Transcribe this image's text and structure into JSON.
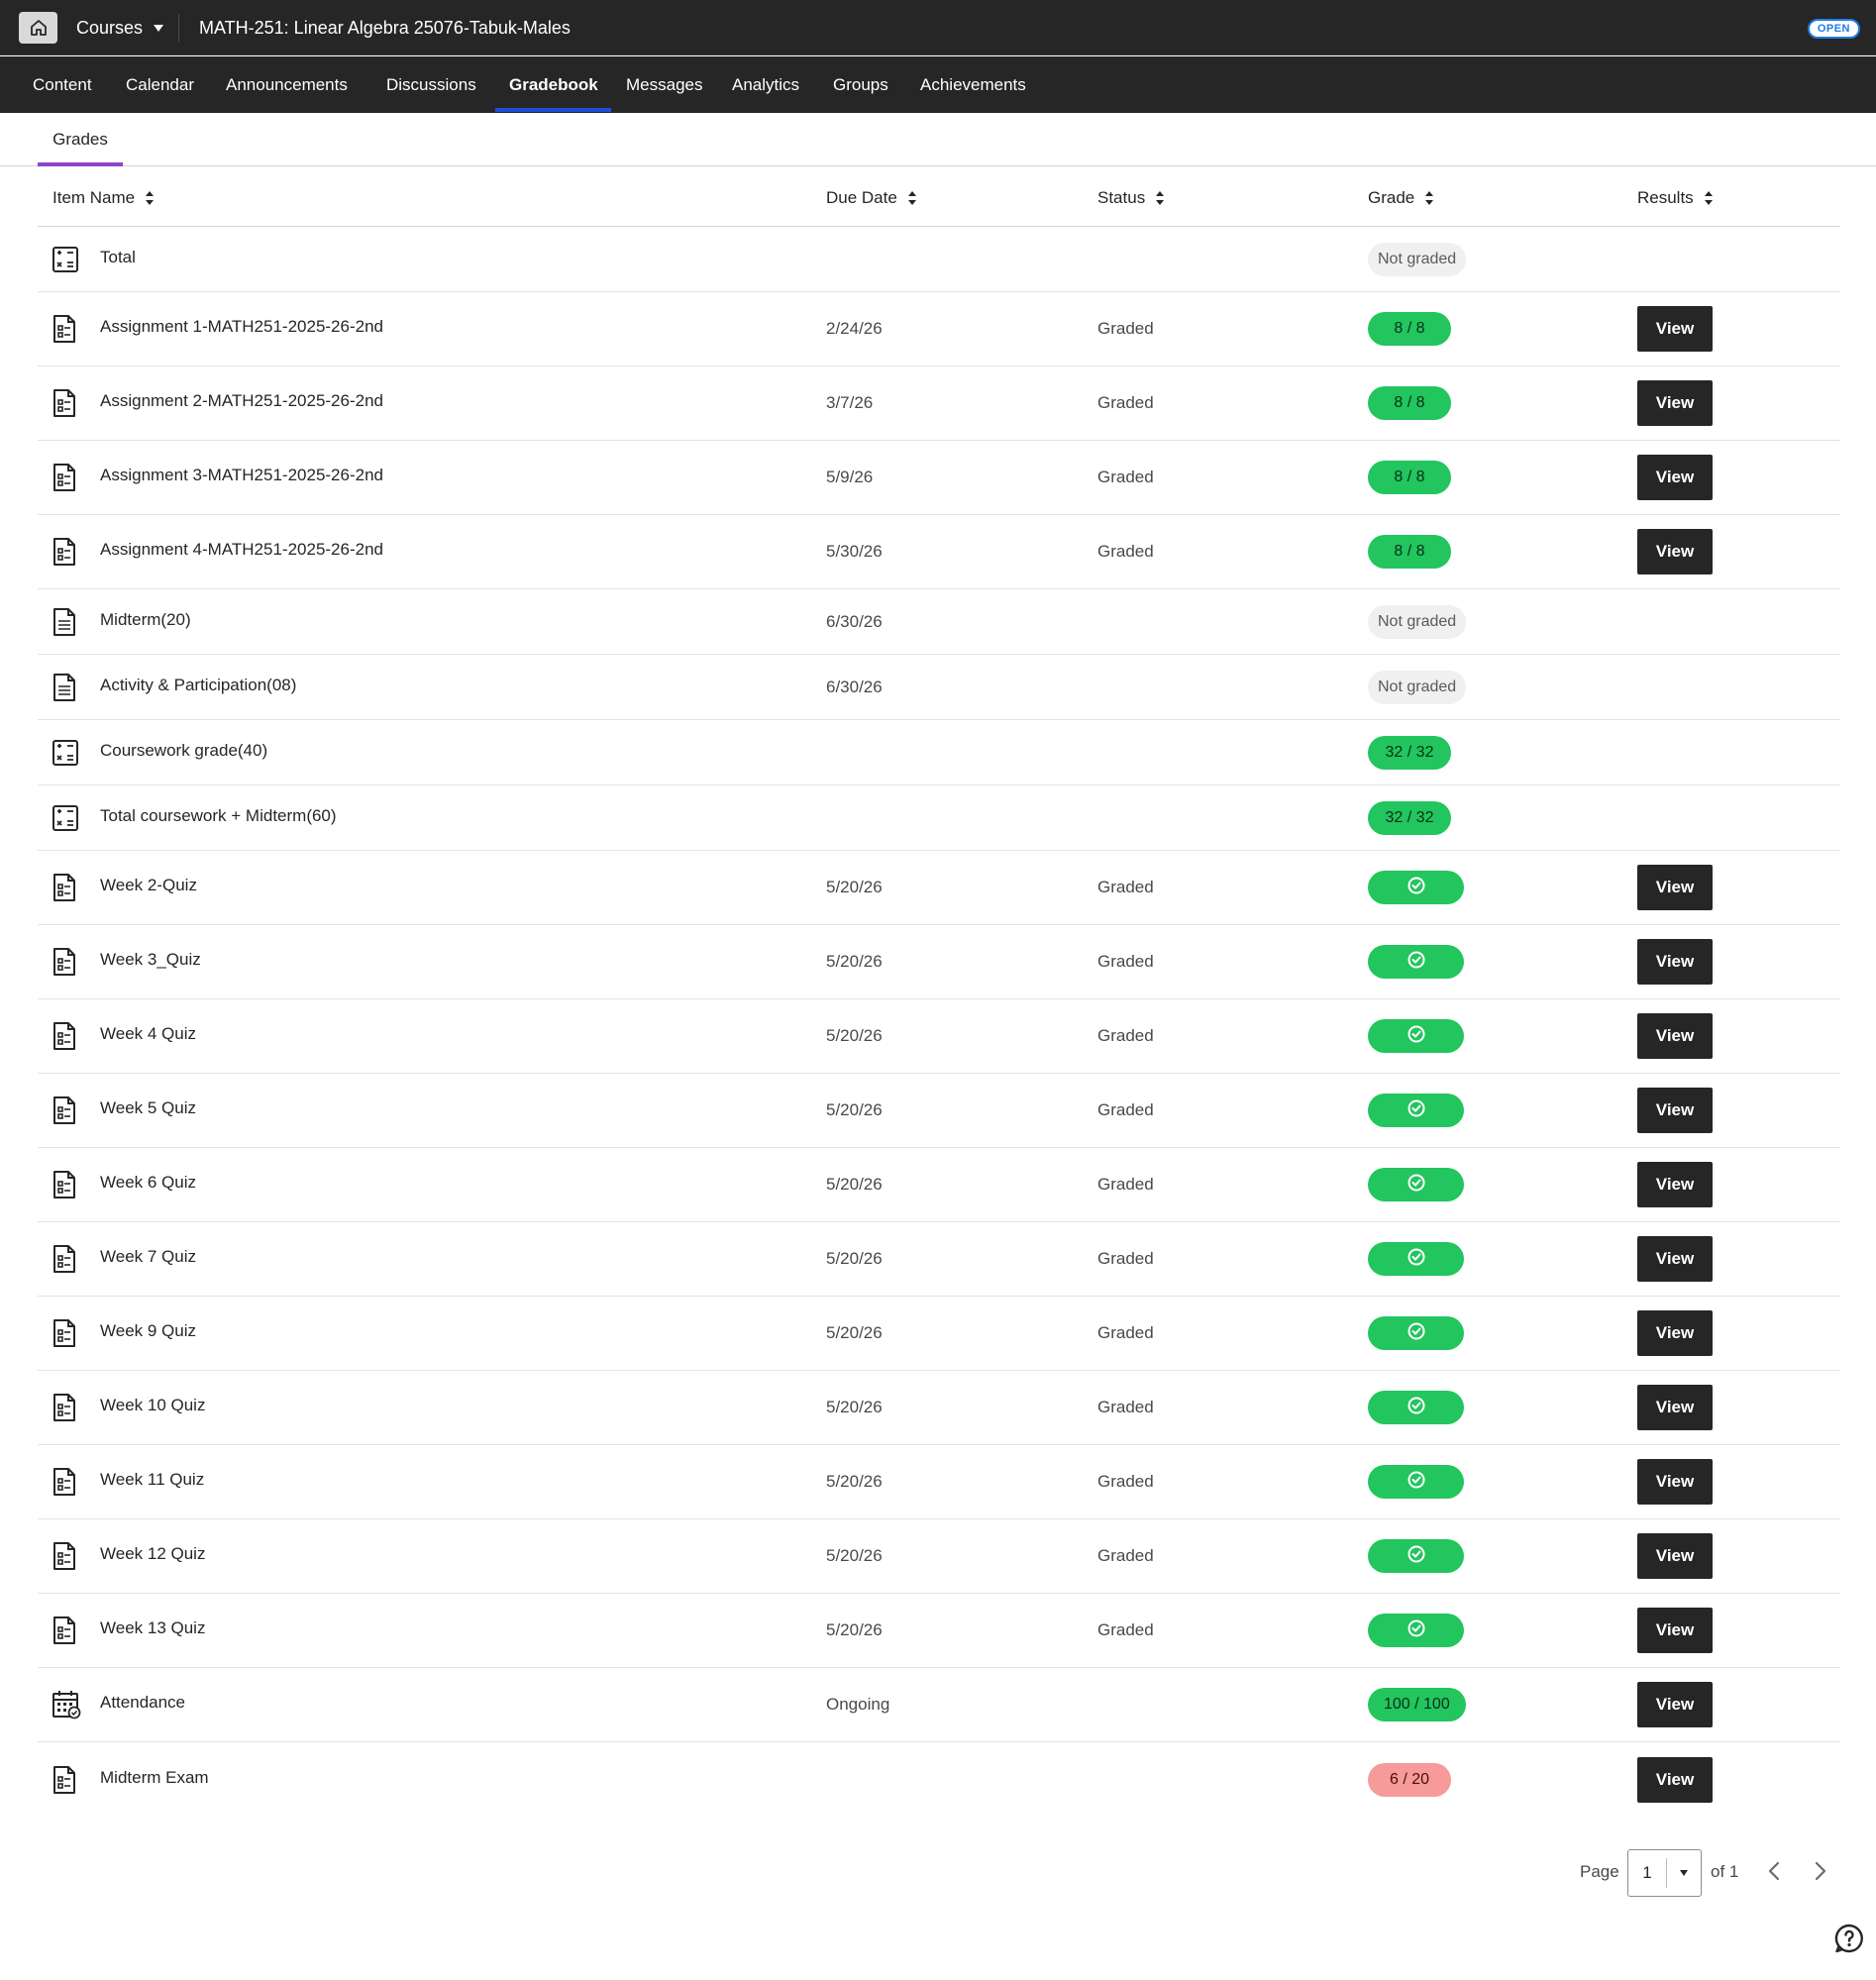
{
  "header": {
    "courses_label": "Courses",
    "course_title": "MATH-251: Linear Algebra 25076-Tabuk-Males",
    "badge": "OPEN"
  },
  "nav": {
    "items": [
      "Content",
      "Calendar",
      "Announcements",
      "Discussions",
      "Gradebook",
      "Messages",
      "Analytics",
      "Groups",
      "Achievements"
    ],
    "active": "Gradebook"
  },
  "subtabs": {
    "active": "Grades"
  },
  "table": {
    "columns": [
      "Item Name",
      "Due Date",
      "Status",
      "Grade",
      "Results"
    ],
    "rows": [
      {
        "icon": "calculator-icon",
        "name": "Total",
        "due": "",
        "status": "",
        "grade": "Not graded",
        "grade_style": "grey",
        "result": ""
      },
      {
        "icon": "assignment-icon",
        "name": "Assignment 1-MATH251-2025-26-2nd",
        "due": "2/24/26",
        "status": "Graded",
        "grade": "8 / 8",
        "grade_style": "green",
        "result": "View"
      },
      {
        "icon": "assignment-icon",
        "name": "Assignment 2-MATH251-2025-26-2nd",
        "due": "3/7/26",
        "status": "Graded",
        "grade": "8 / 8",
        "grade_style": "green",
        "result": "View"
      },
      {
        "icon": "assignment-icon",
        "name": "Assignment 3-MATH251-2025-26-2nd",
        "due": "5/9/26",
        "status": "Graded",
        "grade": "8 / 8",
        "grade_style": "green",
        "result": "View"
      },
      {
        "icon": "assignment-icon",
        "name": "Assignment 4-MATH251-2025-26-2nd",
        "due": "5/30/26",
        "status": "Graded",
        "grade": "8 / 8",
        "grade_style": "green",
        "result": "View"
      },
      {
        "icon": "document-icon",
        "name": "Midterm(20)",
        "due": "6/30/26",
        "status": "",
        "grade": "Not graded",
        "grade_style": "grey",
        "result": ""
      },
      {
        "icon": "document-icon",
        "name": "Activity & Participation(08)",
        "due": "6/30/26",
        "status": "",
        "grade": "Not graded",
        "grade_style": "grey",
        "result": ""
      },
      {
        "icon": "calculator-icon",
        "name": "Coursework grade(40)",
        "due": "",
        "status": "",
        "grade": "32 / 32",
        "grade_style": "green",
        "result": ""
      },
      {
        "icon": "calculator-icon",
        "name": "Total coursework + Midterm(60)",
        "due": "",
        "status": "",
        "grade": "32 / 32",
        "grade_style": "green",
        "result": ""
      },
      {
        "icon": "assignment-icon",
        "name": "Week 2-Quiz",
        "due": "5/20/26",
        "status": "Graded",
        "grade": "",
        "grade_style": "check",
        "result": "View"
      },
      {
        "icon": "assignment-icon",
        "name": "Week 3_Quiz",
        "due": "5/20/26",
        "status": "Graded",
        "grade": "",
        "grade_style": "check",
        "result": "View"
      },
      {
        "icon": "assignment-icon",
        "name": "Week 4 Quiz",
        "due": "5/20/26",
        "status": "Graded",
        "grade": "",
        "grade_style": "check",
        "result": "View"
      },
      {
        "icon": "assignment-icon",
        "name": "Week 5 Quiz",
        "due": "5/20/26",
        "status": "Graded",
        "grade": "",
        "grade_style": "check",
        "result": "View"
      },
      {
        "icon": "assignment-icon",
        "name": "Week 6 Quiz",
        "due": "5/20/26",
        "status": "Graded",
        "grade": "",
        "grade_style": "check",
        "result": "View"
      },
      {
        "icon": "assignment-icon",
        "name": "Week 7 Quiz",
        "due": "5/20/26",
        "status": "Graded",
        "grade": "",
        "grade_style": "check",
        "result": "View"
      },
      {
        "icon": "assignment-icon",
        "name": "Week 9 Quiz",
        "due": "5/20/26",
        "status": "Graded",
        "grade": "",
        "grade_style": "check",
        "result": "View"
      },
      {
        "icon": "assignment-icon",
        "name": "Week 10 Quiz",
        "due": "5/20/26",
        "status": "Graded",
        "grade": "",
        "grade_style": "check",
        "result": "View"
      },
      {
        "icon": "assignment-icon",
        "name": "Week 11 Quiz",
        "due": "5/20/26",
        "status": "Graded",
        "grade": "",
        "grade_style": "check",
        "result": "View"
      },
      {
        "icon": "assignment-icon",
        "name": "Week 12 Quiz",
        "due": "5/20/26",
        "status": "Graded",
        "grade": "",
        "grade_style": "check",
        "result": "View"
      },
      {
        "icon": "assignment-icon",
        "name": "Week 13 Quiz",
        "due": "5/20/26",
        "status": "Graded",
        "grade": "",
        "grade_style": "check",
        "result": "View"
      },
      {
        "icon": "attendance-icon",
        "name": "Attendance",
        "due": "Ongoing",
        "status": "",
        "grade": "100 / 100",
        "grade_style": "green",
        "result": "View"
      },
      {
        "icon": "assignment-icon",
        "name": "Midterm Exam",
        "due": "",
        "status": "",
        "grade": "6 / 20",
        "grade_style": "red",
        "result": "View"
      }
    ]
  },
  "pagination": {
    "page_label": "Page",
    "current_page": "1",
    "of_label": "of 1"
  },
  "colors": {
    "header_bg": "#262626",
    "active_underline": "#1d4ed8",
    "subtab_accent": "#8e44c9",
    "grade_green": "#22c55e",
    "grade_red": "#f69a9a",
    "badge_blue": "#1d7ce8"
  }
}
